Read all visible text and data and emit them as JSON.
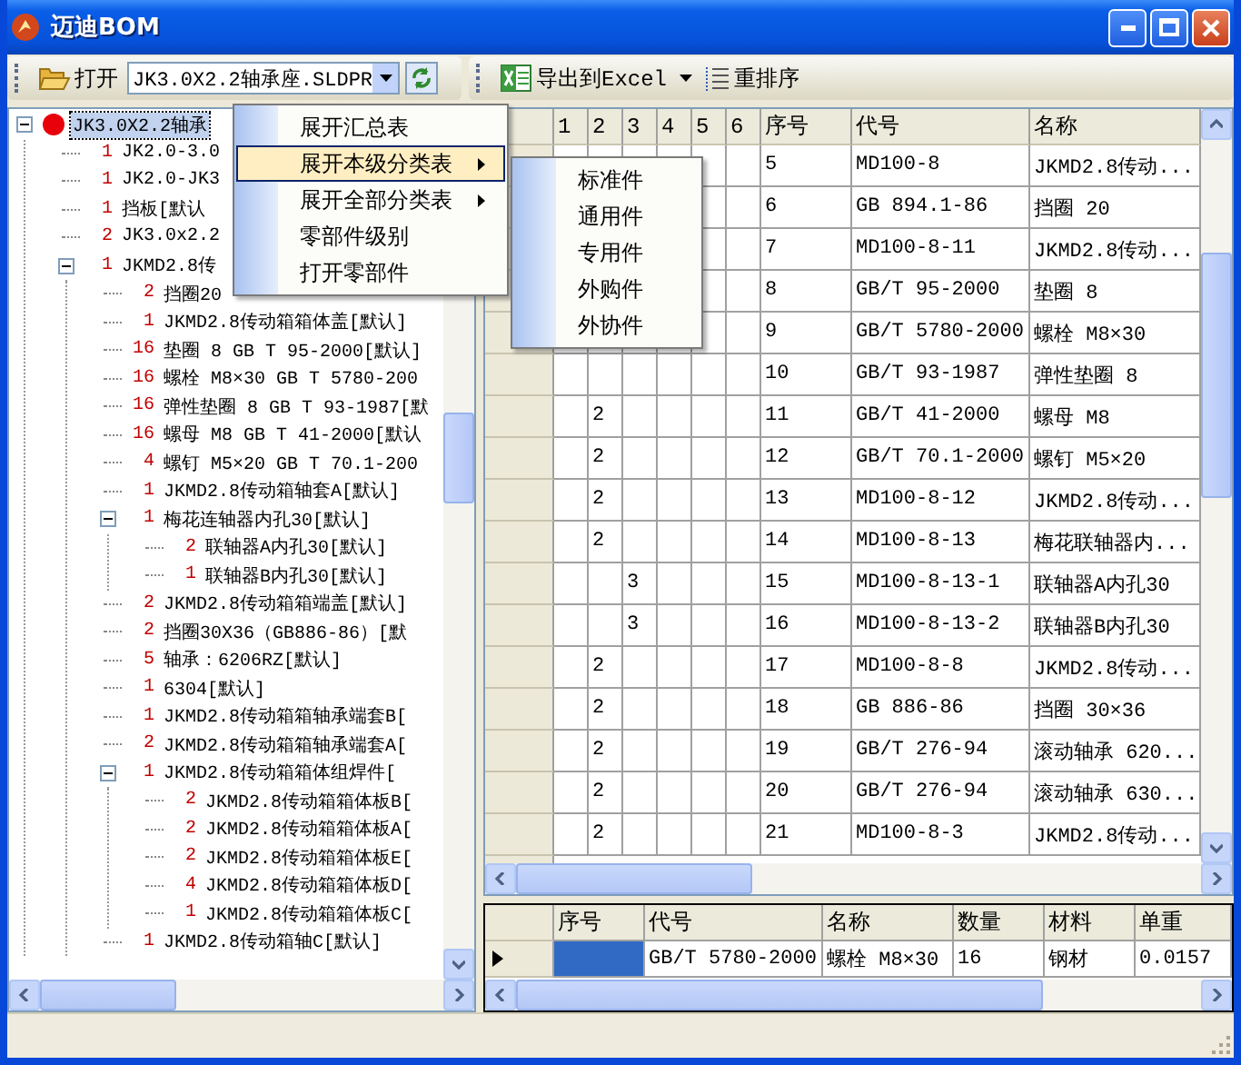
{
  "window": {
    "title": "迈迪BOM"
  },
  "toolbar_left": {
    "open_button": "打开",
    "file_combo": "JK3.0X2.2轴承座.SLDPR"
  },
  "toolbar_right": {
    "export_button": "导出到Excel",
    "reorder_button": "重排序"
  },
  "tree": {
    "root": {
      "label": "JK3.0X2.2轴承",
      "selected": true,
      "expanded": true,
      "children": [
        {
          "qty": "1",
          "label": "JK2.0-3.0"
        },
        {
          "qty": "1",
          "label": "JK2.0-JK3"
        },
        {
          "qty": "1",
          "label": "挡板[默认"
        },
        {
          "qty": "2",
          "label": "JK3.0x2.2"
        },
        {
          "qty": "1",
          "label": "JKMD2.8传",
          "expanded": true,
          "children": [
            {
              "qty": "2",
              "label": "挡圈20"
            },
            {
              "qty": "1",
              "label": "JKMD2.8传动箱箱体盖[默认]"
            },
            {
              "qty": "16",
              "label": "垫圈 8 GB T 95-2000[默认]"
            },
            {
              "qty": "16",
              "label": "螺栓 M8×30 GB T 5780-200"
            },
            {
              "qty": "16",
              "label": "弹性垫圈 8 GB T 93-1987[默"
            },
            {
              "qty": "16",
              "label": "螺母 M8 GB T 41-2000[默认"
            },
            {
              "qty": "4",
              "label": "螺钉 M5×20 GB T 70.1-200"
            },
            {
              "qty": "1",
              "label": "JKMD2.8传动箱轴套A[默认]"
            },
            {
              "qty": "1",
              "label": "梅花连轴器内孔30[默认]",
              "expanded": true,
              "children": [
                {
                  "qty": "2",
                  "label": "联轴器A内孔30[默认]"
                },
                {
                  "qty": "1",
                  "label": "联轴器B内孔30[默认]"
                }
              ]
            },
            {
              "qty": "2",
              "label": "JKMD2.8传动箱箱端盖[默认]"
            },
            {
              "qty": "2",
              "label": "挡圈30X36（GB886-86）[默"
            },
            {
              "qty": "5",
              "label": "轴承：6206RZ[默认]"
            },
            {
              "qty": "1",
              "label": "6304[默认]"
            },
            {
              "qty": "1",
              "label": "JKMD2.8传动箱箱轴承端套B["
            },
            {
              "qty": "2",
              "label": "JKMD2.8传动箱箱轴承端套A["
            },
            {
              "qty": "1",
              "label": "JKMD2.8传动箱箱体组焊件[",
              "expanded": true,
              "children": [
                {
                  "qty": "2",
                  "label": "JKMD2.8传动箱箱体板B["
                },
                {
                  "qty": "2",
                  "label": "JKMD2.8传动箱箱体板A["
                },
                {
                  "qty": "2",
                  "label": "JKMD2.8传动箱箱体板E["
                },
                {
                  "qty": "4",
                  "label": "JKMD2.8传动箱箱体板D["
                },
                {
                  "qty": "1",
                  "label": "JKMD2.8传动箱箱体板C["
                }
              ]
            },
            {
              "qty": "1",
              "label": "JKMD2.8传动箱轴C[默认]"
            }
          ]
        }
      ]
    }
  },
  "context_menu": {
    "items": [
      {
        "label": "展开汇总表",
        "selected": false,
        "submenu": false
      },
      {
        "label": "展开本级分类表",
        "selected": true,
        "submenu": true
      },
      {
        "label": "展开全部分类表",
        "selected": false,
        "submenu": true
      },
      {
        "label": "零部件级别",
        "selected": false,
        "submenu": false
      },
      {
        "label": "打开零部件",
        "selected": false,
        "submenu": false
      }
    ]
  },
  "submenu": {
    "items": [
      "标准件",
      "通用件",
      "专用件",
      "外购件",
      "外协件"
    ]
  },
  "grid": {
    "columns": [
      "1",
      "2",
      "3",
      "4",
      "5",
      "6",
      "序号",
      "代号",
      "名称"
    ],
    "rows": [
      {
        "no": "5",
        "code": "MD100-8",
        "name": "JKMD2.8传动..."
      },
      {
        "no": "6",
        "code": "GB 894.1-86",
        "name": "挡圈  20"
      },
      {
        "no": "7",
        "code": "MD100-8-11",
        "name": "JKMD2.8传动..."
      },
      {
        "no": "8",
        "code": "GB/T 95-2000",
        "name": "垫圈 8"
      },
      {
        "no": "9",
        "code": "GB/T 5780-2000",
        "name": "螺栓 M8×30"
      },
      {
        "no": "10",
        "code": "GB/T 93-1987",
        "name": "弹性垫圈 8"
      },
      {
        "level": "2",
        "no": "11",
        "code": "GB/T 41-2000",
        "name": "螺母 M8"
      },
      {
        "level": "2",
        "no": "12",
        "code": "GB/T 70.1-2000",
        "name": "螺钉 M5×20"
      },
      {
        "level": "2",
        "no": "13",
        "code": "MD100-8-12",
        "name": "JKMD2.8传动..."
      },
      {
        "level": "2",
        "no": "14",
        "code": "MD100-8-13",
        "name": "梅花联轴器内..."
      },
      {
        "level": "3",
        "no": "15",
        "code": "MD100-8-13-1",
        "name": "联轴器A内孔30"
      },
      {
        "level": "3",
        "no": "16",
        "code": "MD100-8-13-2",
        "name": "联轴器B内孔30"
      },
      {
        "level": "2",
        "no": "17",
        "code": "MD100-8-8",
        "name": "JKMD2.8传动..."
      },
      {
        "level": "2",
        "no": "18",
        "code": "GB 886-86",
        "name": "挡圈  30×36"
      },
      {
        "level": "2",
        "no": "19",
        "code": "GB/T 276-94",
        "name": "滚动轴承 620..."
      },
      {
        "level": "2",
        "no": "20",
        "code": "GB/T 276-94",
        "name": "滚动轴承 630..."
      },
      {
        "level": "2",
        "no": "21",
        "code": "MD100-8-3",
        "name": "JKMD2.8传动..."
      }
    ]
  },
  "detail": {
    "columns": [
      "序号",
      "代号",
      "名称",
      "数量",
      "材料",
      "单重"
    ],
    "row": {
      "current": true,
      "no_selected": true,
      "code": "GB/T 5780-2000",
      "name": "螺栓 M8×30",
      "qty": "16",
      "material": "钢材",
      "unit_weight": "0.0157"
    }
  }
}
